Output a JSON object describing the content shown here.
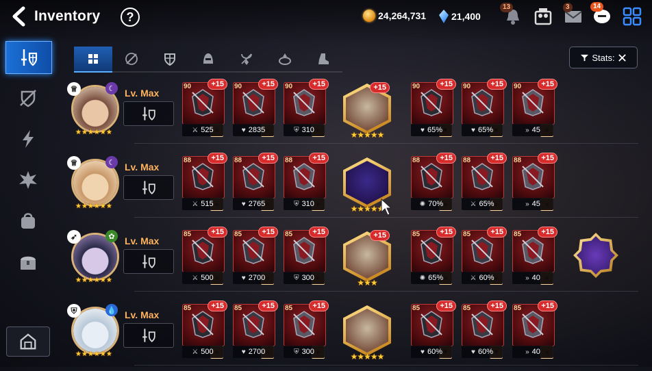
{
  "header": {
    "title": "Inventory",
    "help_icon": "question-circle-icon",
    "gold": "24,264,731",
    "crystals": "21,400",
    "notifications": {
      "bell": "13",
      "mail": "3",
      "chat": "14"
    }
  },
  "sidebar": {
    "items": [
      {
        "name": "equipment",
        "icon": "sword-shield-icon",
        "active": true
      },
      {
        "name": "unequipped",
        "icon": "broken-shield-icon"
      },
      {
        "name": "catalyst",
        "icon": "lightning-icon"
      },
      {
        "name": "materials",
        "icon": "splash-icon"
      },
      {
        "name": "bag",
        "icon": "bag-icon"
      },
      {
        "name": "chest",
        "icon": "treasure-chest-icon"
      }
    ],
    "bottom_icon": "storage-house-icon"
  },
  "tabs": [
    {
      "name": "all",
      "icon": "grid-icon",
      "active": true
    },
    {
      "name": "weapon",
      "icon": "weapon-icon"
    },
    {
      "name": "armor",
      "icon": "shield-icon"
    },
    {
      "name": "helmet",
      "icon": "helmet-icon"
    },
    {
      "name": "necklace",
      "icon": "necklace-icon"
    },
    {
      "name": "ring",
      "icon": "ring-icon"
    },
    {
      "name": "boots",
      "icon": "boots-icon"
    }
  ],
  "stats_button": {
    "label": "Stats:"
  },
  "level_label": "Lv. Max",
  "heroes": [
    {
      "stars": 6,
      "gear": [
        {
          "level": "90",
          "enh": "+15",
          "stat_icon": "attack",
          "stat": "525"
        },
        {
          "level": "90",
          "enh": "+15",
          "stat_icon": "health",
          "stat": "2835"
        },
        {
          "level": "90",
          "enh": "+15",
          "stat_icon": "defense",
          "stat": "310"
        }
      ],
      "artifact": {
        "enh": "+15",
        "stars": 5
      },
      "accessories": [
        {
          "level": "90",
          "enh": "+15",
          "stat_icon": "health",
          "stat": "65%"
        },
        {
          "level": "90",
          "enh": "+15",
          "stat_icon": "health",
          "stat": "65%"
        },
        {
          "level": "90",
          "enh": "+15",
          "stat_icon": "speed",
          "stat": "45"
        }
      ]
    },
    {
      "stars": 6,
      "gear": [
        {
          "level": "88",
          "enh": "+15",
          "stat_icon": "attack",
          "stat": "515"
        },
        {
          "level": "88",
          "enh": "+15",
          "stat_icon": "health",
          "stat": "2765"
        },
        {
          "level": "88",
          "enh": "+15",
          "stat_icon": "defense",
          "stat": "310"
        }
      ],
      "artifact": {
        "enh": "",
        "stars": 5
      },
      "accessories": [
        {
          "level": "88",
          "enh": "+15",
          "stat_icon": "crit",
          "stat": "70%"
        },
        {
          "level": "88",
          "enh": "+15",
          "stat_icon": "attack",
          "stat": "65%"
        },
        {
          "level": "88",
          "enh": "+15",
          "stat_icon": "speed",
          "stat": "45"
        }
      ]
    },
    {
      "stars": 6,
      "gear": [
        {
          "level": "85",
          "enh": "+15",
          "stat_icon": "attack",
          "stat": "500"
        },
        {
          "level": "85",
          "enh": "+15",
          "stat_icon": "health",
          "stat": "2700"
        },
        {
          "level": "85",
          "enh": "+15",
          "stat_icon": "defense",
          "stat": "300"
        }
      ],
      "artifact": {
        "enh": "+15",
        "stars": 3
      },
      "accessories": [
        {
          "level": "85",
          "enh": "+15",
          "stat_icon": "crit",
          "stat": "65%"
        },
        {
          "level": "85",
          "enh": "+15",
          "stat_icon": "attack",
          "stat": "60%"
        },
        {
          "level": "85",
          "enh": "+15",
          "stat_icon": "speed",
          "stat": "40"
        }
      ]
    },
    {
      "stars": 6,
      "gear": [
        {
          "level": "85",
          "enh": "+15",
          "stat_icon": "attack",
          "stat": "500"
        },
        {
          "level": "85",
          "enh": "+15",
          "stat_icon": "health",
          "stat": "2700"
        },
        {
          "level": "85",
          "enh": "+15",
          "stat_icon": "defense",
          "stat": "300"
        }
      ],
      "artifact": {
        "enh": "",
        "stars": 5
      },
      "accessories": [
        {
          "level": "85",
          "enh": "+15",
          "stat_icon": "health",
          "stat": "60%"
        },
        {
          "level": "85",
          "enh": "+15",
          "stat_icon": "health",
          "stat": "60%"
        },
        {
          "level": "85",
          "enh": "+15",
          "stat_icon": "speed",
          "stat": "40"
        }
      ]
    }
  ],
  "colors": {
    "accent_blue": "#1b6fd6",
    "gear_red": "#8c1e22",
    "enh_badge": "#d82b2b",
    "level_orange": "#ffb35c",
    "set_orange": "#e8821e"
  }
}
